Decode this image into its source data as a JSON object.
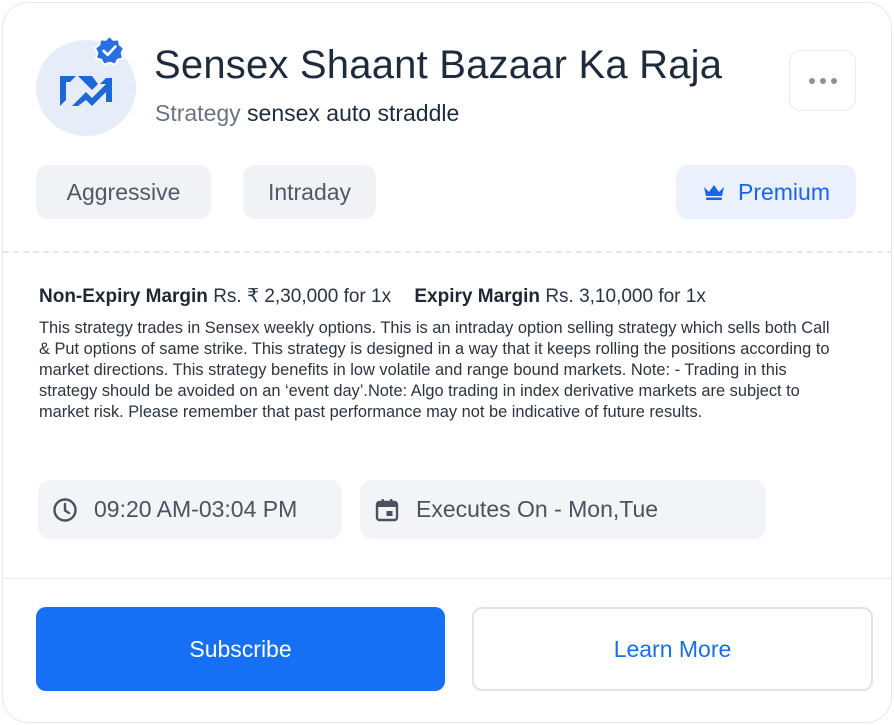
{
  "header": {
    "title": "Sensex Shaant Bazaar Ka Raja",
    "subtitle_prefix": "Strategy",
    "subtitle_name": "sensex auto straddle"
  },
  "tags": {
    "risk": "Aggressive",
    "type": "Intraday",
    "premium": "Premium"
  },
  "margins": {
    "non_expiry_label": "Non-Expiry Margin",
    "non_expiry_value": "Rs. ₹ 2,30,000 for 1x",
    "expiry_label": "Expiry Margin",
    "expiry_value": "Rs. 3,10,000 for 1x"
  },
  "description": "This strategy trades in Sensex weekly options. This is an intraday option selling strategy which sells both Call & Put options of same strike. This strategy is designed in a way that it keeps rolling the positions according to market directions. This strategy benefits in low volatile and range bound markets. Note: - Trading in this strategy should be avoided on an ‘event day’.Note: Algo trading in index derivative markets are subject to market risk. Please remember that past performance may not be indicative of future results.",
  "schedule": {
    "time": "09:20 AM-03:04 PM",
    "days": "Executes On - Mon,Tue"
  },
  "actions": {
    "subscribe": "Subscribe",
    "learn_more": "Learn More"
  },
  "colors": {
    "accent": "#1670f5",
    "premium_text": "#1967e8",
    "verified_badge": "#2a6fe0"
  },
  "icons": {
    "logo": "strategy-logo-icon",
    "verified": "verified-badge-icon",
    "more": "more-options-icon",
    "premium": "crown-icon",
    "time": "clock-icon",
    "days": "calendar-icon"
  }
}
